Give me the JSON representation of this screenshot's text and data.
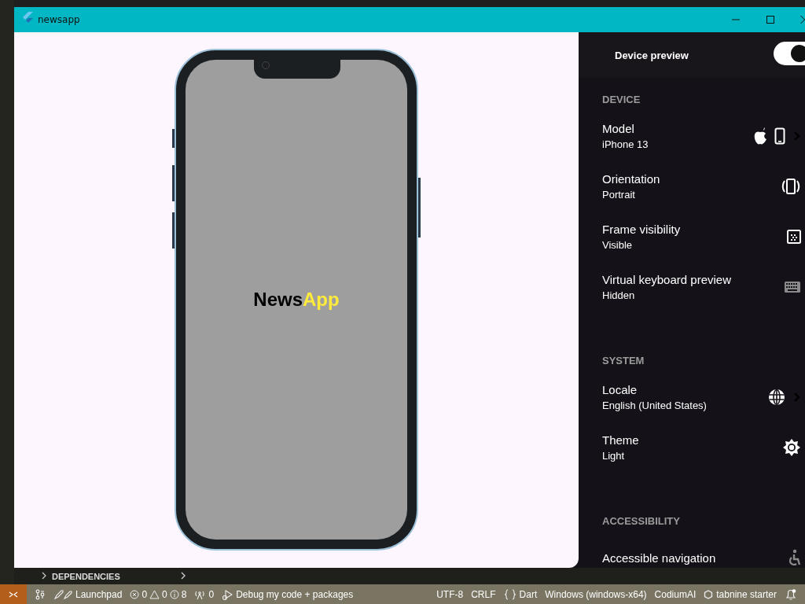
{
  "window": {
    "title": "newsapp"
  },
  "app_screen": {
    "title_parts": [
      {
        "text": "News",
        "color": "#000000"
      },
      {
        "text": "App",
        "color": "#ffeb3b"
      }
    ]
  },
  "device_preview": {
    "title": "Device preview",
    "enabled": true,
    "sections": [
      {
        "title": "DEVICE",
        "items": [
          {
            "kind": "model",
            "label": "Model",
            "value": "iPhone 13"
          },
          {
            "kind": "orientation",
            "label": "Orientation",
            "value": "Portrait"
          },
          {
            "kind": "frame",
            "label": "Frame visibility",
            "value": "Visible"
          },
          {
            "kind": "keyboard",
            "label": "Virtual keyboard preview",
            "value": "Hidden"
          }
        ]
      },
      {
        "title": "SYSTEM",
        "items": [
          {
            "kind": "locale",
            "label": "Locale",
            "value": "English (United States)"
          },
          {
            "kind": "theme",
            "label": "Theme",
            "value": "Light"
          }
        ]
      },
      {
        "title": "ACCESSIBILITY",
        "items": [
          {
            "kind": "accessibility",
            "label": "Accessible navigation"
          }
        ]
      }
    ]
  },
  "explorer": {
    "section": "DEPENDENCIES"
  },
  "status_bar": [
    {
      "kind": "remote"
    },
    {
      "kind": "branch"
    },
    {
      "kind": "launchpad",
      "text": "Launchpad"
    },
    {
      "kind": "problems",
      "errors": "0",
      "warnings": "0",
      "infos": "8"
    },
    {
      "kind": "ports",
      "text": "0"
    },
    {
      "kind": "debug",
      "text": "Debug my code + packages"
    },
    {
      "kind": "spacer"
    },
    {
      "kind": "text",
      "text": "UTF-8"
    },
    {
      "kind": "text",
      "text": "CRLF"
    },
    {
      "kind": "language",
      "text": "Dart"
    },
    {
      "kind": "text",
      "text": "Windows (windows-x64)"
    },
    {
      "kind": "text",
      "text": "CodiumAI"
    },
    {
      "kind": "tabnine",
      "text": "tabnine starter"
    },
    {
      "kind": "bell"
    }
  ]
}
